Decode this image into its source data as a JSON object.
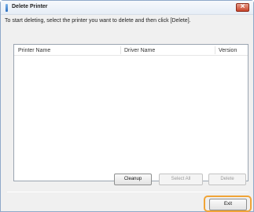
{
  "window": {
    "title": "Delete Printer"
  },
  "instruction": "To start deleting, select the printer you want to delete and then click [Delete].",
  "list": {
    "columns": [
      "Printer Name",
      "Driver Name",
      "Version"
    ],
    "rows": []
  },
  "buttons": {
    "cleanup": "Cleanup",
    "select_all": "Select All",
    "delete": "Delete",
    "exit": "Exit"
  },
  "colors": {
    "highlight": "#f0a437",
    "close": "#c7432a"
  },
  "icons": {
    "app": "printer-app-icon",
    "close": "close-icon"
  }
}
